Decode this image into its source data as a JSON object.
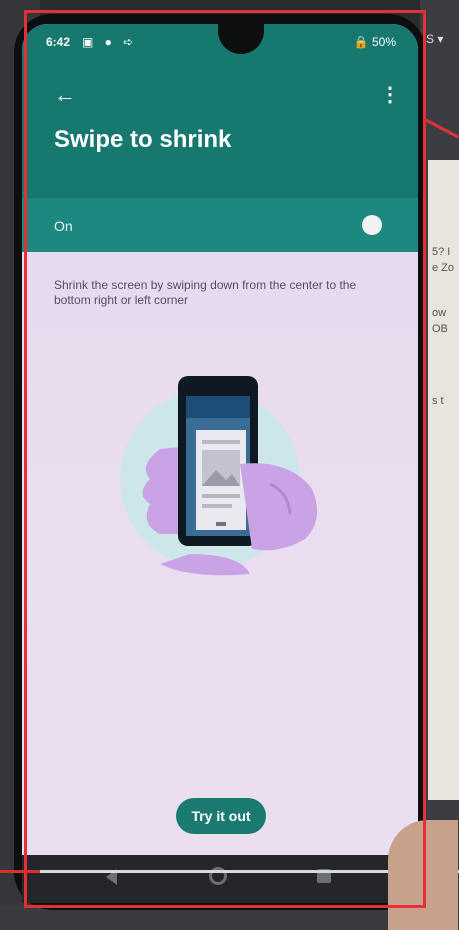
{
  "status_bar": {
    "time": "6:42",
    "icons": "▣ ● ➪",
    "battery": "🔒 50%"
  },
  "app_bar": {
    "back_icon": "←",
    "more_icon": "⋮",
    "title": "Swipe to shrink"
  },
  "toggle": {
    "label": "On",
    "state": "on"
  },
  "description": "Shrink the screen by swiping down from the center to the bottom right or left corner",
  "illustration": {
    "name": "phone-in-hand-illustration"
  },
  "try_button": {
    "label": "Try it out"
  },
  "background": {
    "corner_text": "S ▾",
    "paper_lines": [
      "5? I",
      "e Zo",
      "ow",
      "OB",
      "s t"
    ]
  },
  "colors": {
    "accent": "#16786f",
    "toggle_row": "#1d8880",
    "annotation": "#e53035"
  }
}
